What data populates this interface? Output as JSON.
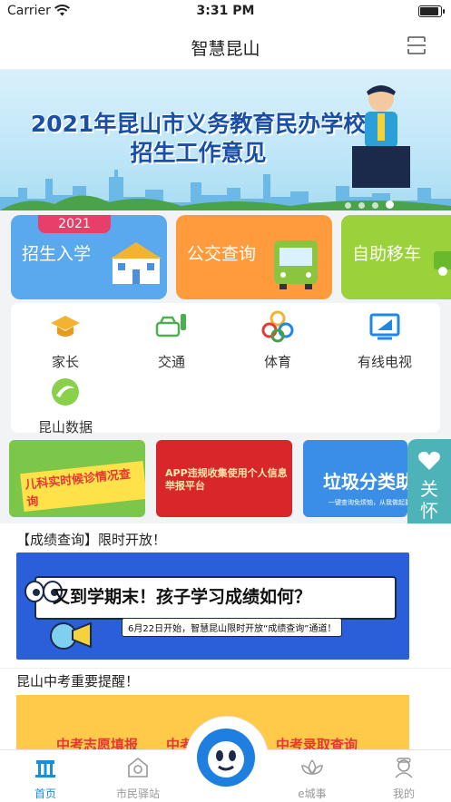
{
  "status_bar": {
    "carrier": "Carrier",
    "time": "3:31 PM",
    "battery_level": 1.0
  },
  "nav": {
    "title": "智慧昆山",
    "scan_icon": "scan-icon"
  },
  "banner": {
    "line1": "2021年昆山市义务教育民办学校",
    "line2": "招生工作意见",
    "slide_count": 4,
    "active_slide": 4
  },
  "tiles": [
    {
      "label": "招生入学",
      "tag": "2021",
      "color": "#5aa8ee"
    },
    {
      "label": "公交查询",
      "color": "#ff9b3d"
    },
    {
      "label": "自助移车",
      "color": "#9bd23c"
    }
  ],
  "services": [
    {
      "label": "家长",
      "icon": "graduation-cap-icon"
    },
    {
      "label": "交通",
      "icon": "car-traffic-light-icon"
    },
    {
      "label": "体育",
      "icon": "sports-rings-icon"
    },
    {
      "label": "有线电视",
      "icon": "tv-icon"
    },
    {
      "label": "昆山数据",
      "icon": "data-swirl-icon"
    }
  ],
  "promos": [
    {
      "text": "儿科实时候诊情况查询",
      "color": "#7cc64a"
    },
    {
      "text": "APP违规收集使用个人信息举报平台",
      "color": "#d8262b"
    },
    {
      "text": "垃圾分类助手",
      "sub": "一键查询免烦恼，从我做起要环保",
      "color": "#3a8ee6"
    }
  ],
  "care_mode": {
    "label": "关怀模式"
  },
  "news": [
    {
      "title": "【成绩查询】限时开放！",
      "headline": "又到学期末！孩子学习成绩如何？",
      "sub": "6月22日开始，智慧昆山限时开放“成绩查询”通道！"
    },
    {
      "title": "昆山中考重要提醒！",
      "items": [
        "中考志愿填报",
        "中考成绩查询",
        "中考录取查询"
      ]
    }
  ],
  "tabbar": [
    {
      "label": "首页",
      "icon": "home-icon",
      "active": true
    },
    {
      "label": "市民驿站",
      "icon": "station-icon",
      "active": false
    },
    {
      "label": "e城事",
      "icon": "lotus-icon",
      "active": false
    },
    {
      "label": "我的",
      "icon": "profile-icon",
      "active": false
    }
  ]
}
